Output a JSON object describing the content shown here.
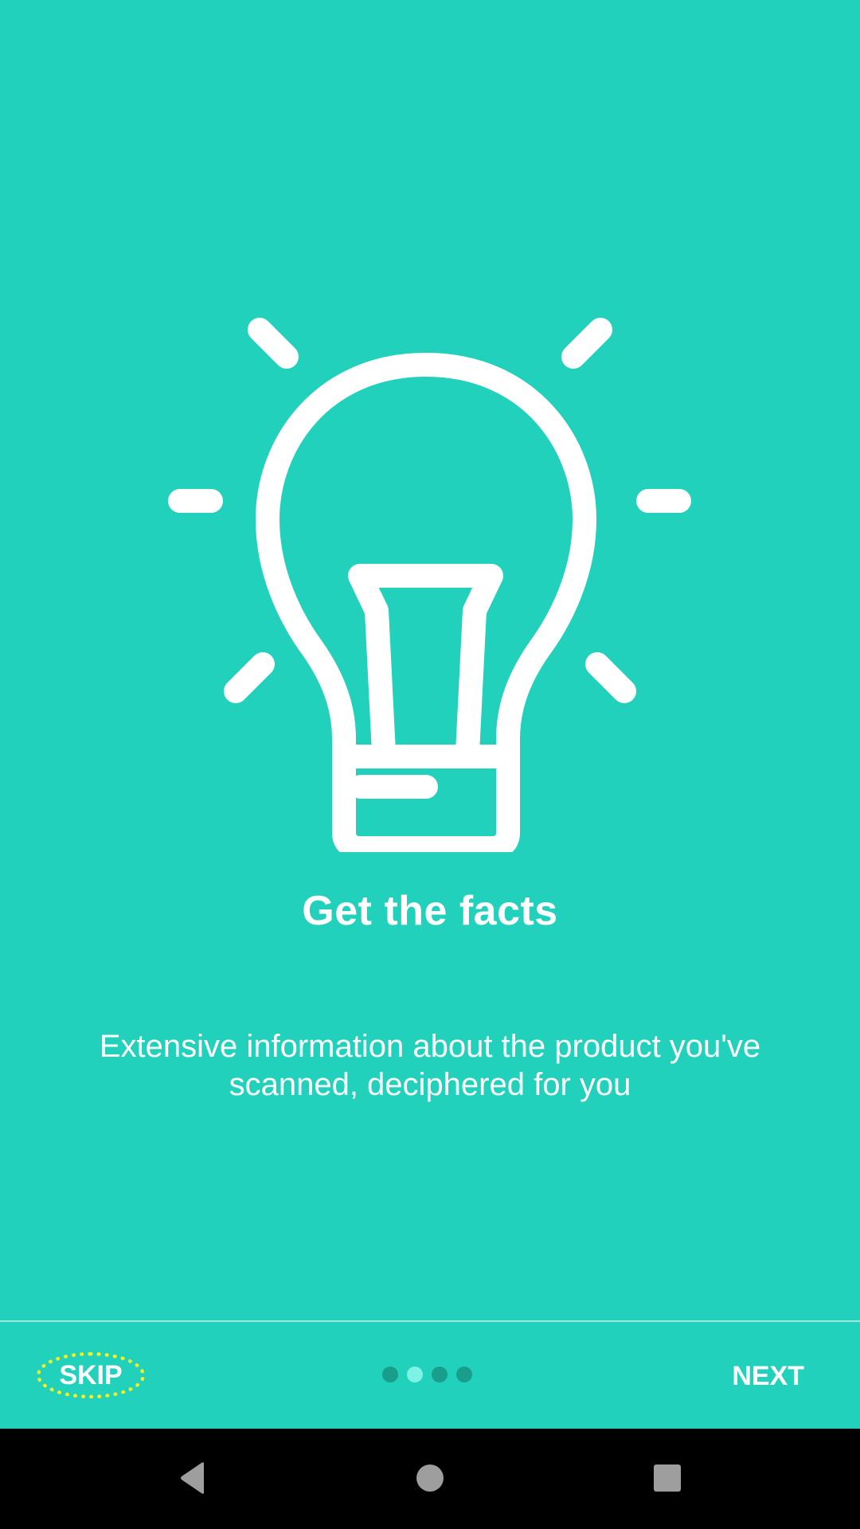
{
  "onboarding": {
    "title": "Get the facts",
    "description": "Extensive information about the product you've scanned, deciphered for you",
    "illustration": "lightbulb-icon",
    "background_color": "#22d1bb"
  },
  "bottom_bar": {
    "skip_label": "SKIP",
    "next_label": "NEXT",
    "pager": {
      "total_pages": 4,
      "current_page": 2
    }
  },
  "navbar": {
    "back": "back-icon",
    "home": "home-icon",
    "recents": "recents-icon"
  }
}
